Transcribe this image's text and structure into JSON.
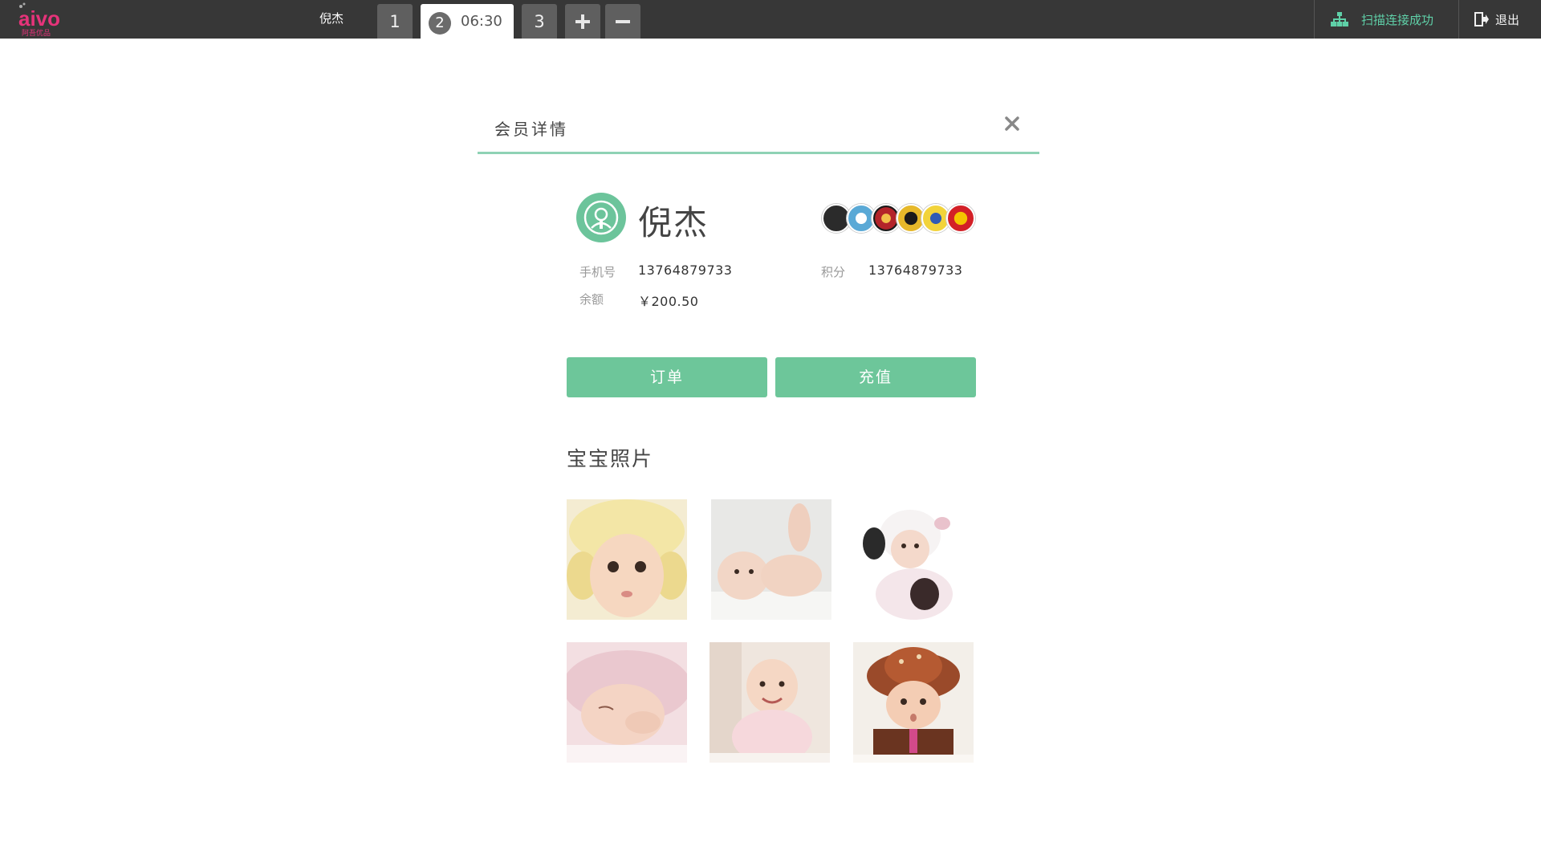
{
  "app": {
    "logo_text": "aivo",
    "logo_subtext": "阿吾优品",
    "current_user": "倪杰"
  },
  "tabs": [
    {
      "label": "1"
    },
    {
      "label": "2",
      "time": "06:30",
      "active": true
    },
    {
      "label": "3"
    }
  ],
  "tab_actions": {
    "add_icon": "plus-icon",
    "remove_icon": "minus-icon"
  },
  "header_right": {
    "scan_status": "扫描连接成功",
    "scan_icon": "network-icon",
    "logout": "退出",
    "logout_icon": "exit-icon"
  },
  "dialog": {
    "title": "会员详情",
    "close_icon": "close-icon"
  },
  "member": {
    "name": "倪杰",
    "avatar_icon": "user-icon",
    "phone_label": "手机号",
    "phone": "13764879733",
    "points_label": "积分",
    "points": "13764879733",
    "balance_label": "余额",
    "balance": "￥200.50",
    "badges": [
      "brand-badge-1",
      "brand-badge-2",
      "brand-badge-3",
      "brand-badge-4",
      "brand-badge-5",
      "brand-badge-6"
    ]
  },
  "actions": {
    "orders": "订单",
    "recharge": "充值"
  },
  "photos": {
    "title": "宝宝照片",
    "items": [
      "baby-photo-1",
      "baby-photo-2",
      "baby-photo-3",
      "baby-photo-4",
      "baby-photo-5",
      "baby-photo-6"
    ]
  },
  "colors": {
    "topbar": "#373737",
    "accent_green": "#6dc69a",
    "scan_text": "#5fd0a8",
    "logo_pink": "#e6337a"
  }
}
